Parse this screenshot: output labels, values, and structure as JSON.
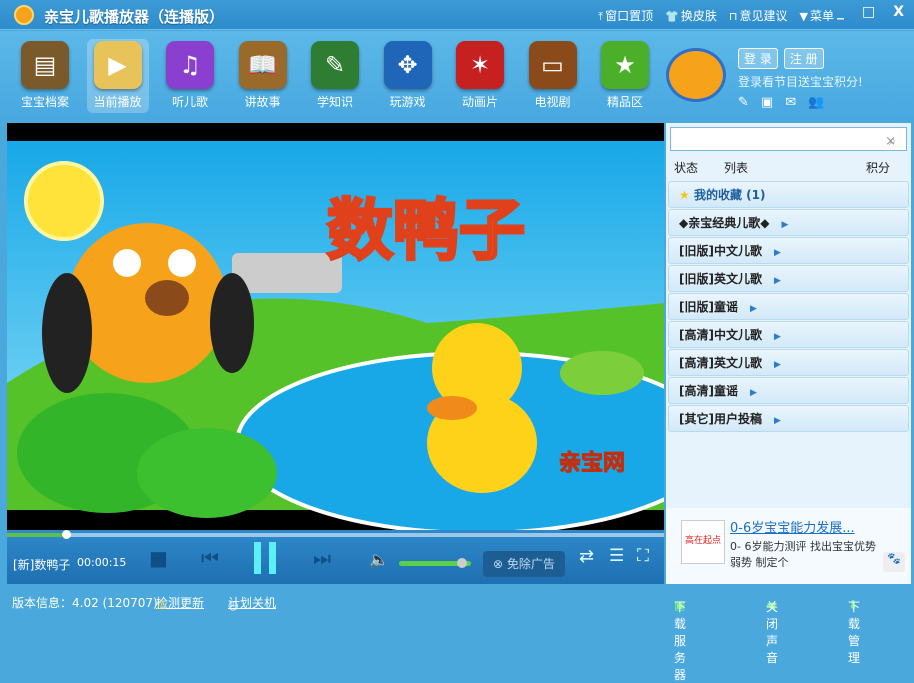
{
  "app": {
    "title": "亲宝儿歌播放器（连播版）"
  },
  "titlebar": {
    "actions": [
      {
        "icon": "pin-icon",
        "label": "窗口置顶"
      },
      {
        "icon": "shirt-icon",
        "label": "换皮肤"
      },
      {
        "icon": "feedback-icon",
        "label": "意见建议"
      },
      {
        "icon": "menu-icon",
        "label": "菜单"
      }
    ],
    "min": "_",
    "max": "□",
    "close": "X"
  },
  "nav": [
    {
      "label": "宝宝档案",
      "icon": "profile-book-icon",
      "color": "#7a5a2a"
    },
    {
      "label": "当前播放",
      "icon": "now-playing-icon",
      "color": "#e8c35a",
      "active": true
    },
    {
      "label": "听儿歌",
      "icon": "music-note-icon",
      "color": "#8a3fd0"
    },
    {
      "label": "讲故事",
      "icon": "storybook-icon",
      "color": "#9a6a2a"
    },
    {
      "label": "学知识",
      "icon": "knowledge-book-icon",
      "color": "#2e7d32"
    },
    {
      "label": "玩游戏",
      "icon": "joystick-icon",
      "color": "#1f65b8"
    },
    {
      "label": "动画片",
      "icon": "animation-icon",
      "color": "#c62020"
    },
    {
      "label": "电视剧",
      "icon": "tv-icon",
      "color": "#8a4a1a"
    },
    {
      "label": "精品区",
      "icon": "star-icon",
      "color": "#4caf2a"
    }
  ],
  "login": {
    "login": "登 录",
    "register": "注 册",
    "hint": "登录看节目送宝宝积分!"
  },
  "video": {
    "title_art": "数鸭子",
    "watermark": "亲宝网"
  },
  "player": {
    "now_playing": "[新]数鸭子",
    "time": "00:00:15",
    "progress": 0.09,
    "volume": 0.95,
    "ad_free": "免除广告"
  },
  "sidebar": {
    "search_placeholder": "",
    "columns": [
      "状态",
      "列表",
      "积分"
    ],
    "categories": [
      "我的收藏 (1)",
      "◆亲宝经典儿歌◆",
      "[旧版]中文儿歌",
      "[旧版]英文儿歌",
      "[旧版]童谣",
      "[高清]中文儿歌",
      "[高清]英文儿歌",
      "[高清]童谣",
      "[其它]用户投稿"
    ],
    "ad": {
      "title": "0-6岁宝宝能力发展...",
      "desc": "0- 6岁能力测评 找出宝宝优势弱势 制定个",
      "logo": "高在起点"
    }
  },
  "status": {
    "version": "版本信息：4.02 (120707)",
    "check_update": "检测更新",
    "schedule_off": "计划关机",
    "download_server": "下载服务器",
    "mute": "关闭声音",
    "download_manager": "下载管理"
  }
}
